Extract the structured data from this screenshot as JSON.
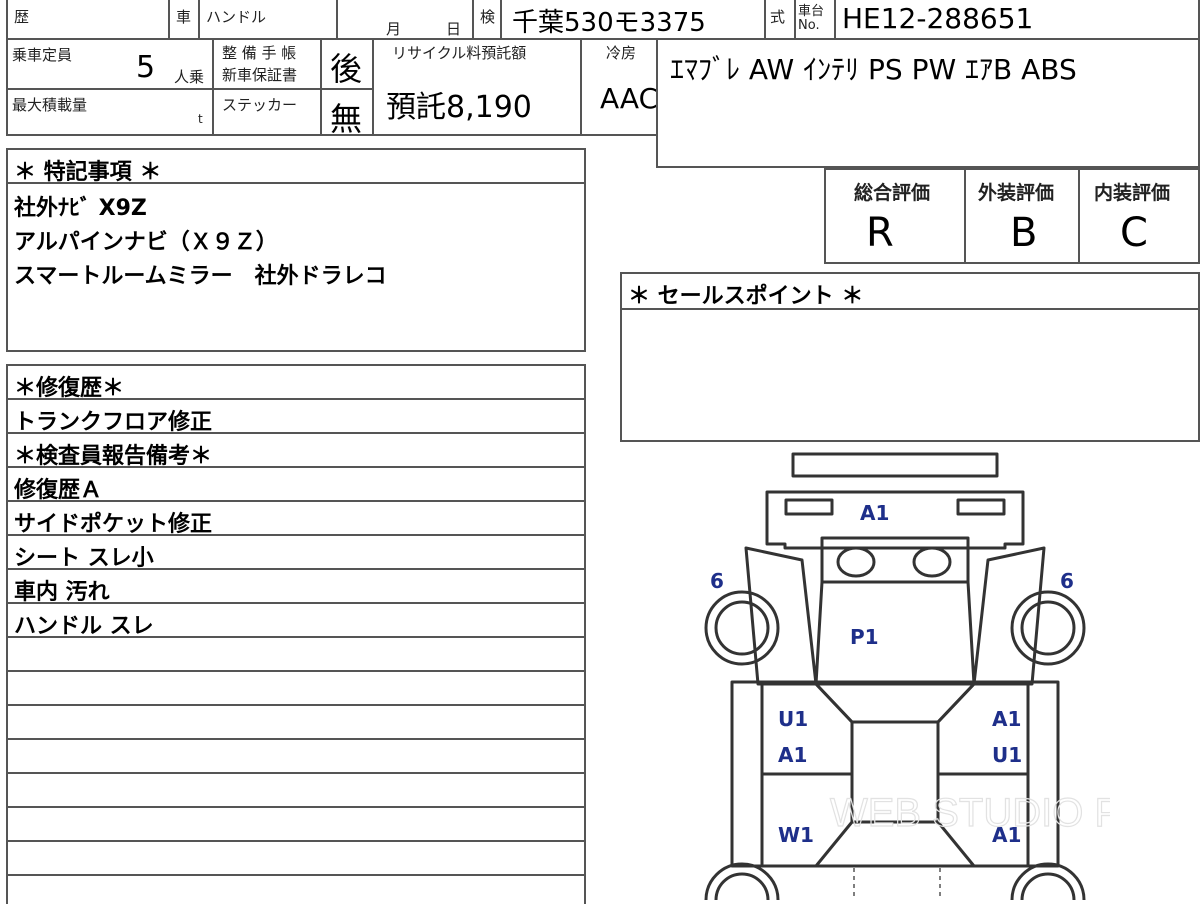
{
  "header": {
    "history_label": "歴",
    "car_label": "車",
    "handle_label": "ハンドル",
    "month_label": "月",
    "day_label": "日",
    "inspection_label": "検",
    "plate_value": "千葉530モ3375",
    "type_label": "式",
    "chassis_label_1": "車台",
    "chassis_label_2": "No.",
    "chassis_value": "HE12-288651"
  },
  "specs": {
    "capacity_label": "乗車定員",
    "capacity_value": "5",
    "capacity_unit": "人乗",
    "maint_label_1": "整 備 手 帳",
    "maint_label_2": "新車保証書",
    "maint_value": "後",
    "max_load_label": "最大積載量",
    "max_load_unit": "t",
    "sticker_label": "ステッカー",
    "sticker_value": "無",
    "recycle_label": "リサイクル料預託額",
    "recycle_value": "預託8,190",
    "ac_label": "冷房",
    "ac_value": "AAC",
    "equipment_value": "ｴﾏﾌﾞﾚ AW ｲﾝﾃﾘ PS PW ｴｱB ABS"
  },
  "grades": {
    "overall_label": "総合評価",
    "exterior_label": "外装評価",
    "interior_label": "内装評価",
    "overall_value": "R",
    "exterior_value": "B",
    "interior_value": "C"
  },
  "notes": {
    "title": "＊ 特記事項 ＊",
    "lines": [
      "社外ﾅﾋﾞ X9Z",
      "アルパインナビ（Ｘ９Ｚ）",
      "スマートルームミラー　社外ドラレコ"
    ]
  },
  "sales": {
    "title": "＊ セールスポイント ＊"
  },
  "repair": {
    "title": "＊修復歴＊",
    "line": "トランクフロア修正",
    "inspector_title": "＊検査員報告備考＊",
    "lines": [
      "修復歴Ａ",
      "サイドポケット修正",
      "シート スレ小",
      "車内 汚れ",
      "ハンドル スレ"
    ]
  },
  "diagram": {
    "marks": {
      "front": "A1",
      "tire_left": "6",
      "tire_right": "6",
      "hood": "P1",
      "left_u1": "U1",
      "left_a1": "A1",
      "left_w1": "W1",
      "right_a1_top": "A1",
      "right_u1": "U1",
      "right_a1_bottom": "A1"
    },
    "watermark": "WEB STUDIO PRO",
    "mark_color": "#1e2f8a"
  }
}
